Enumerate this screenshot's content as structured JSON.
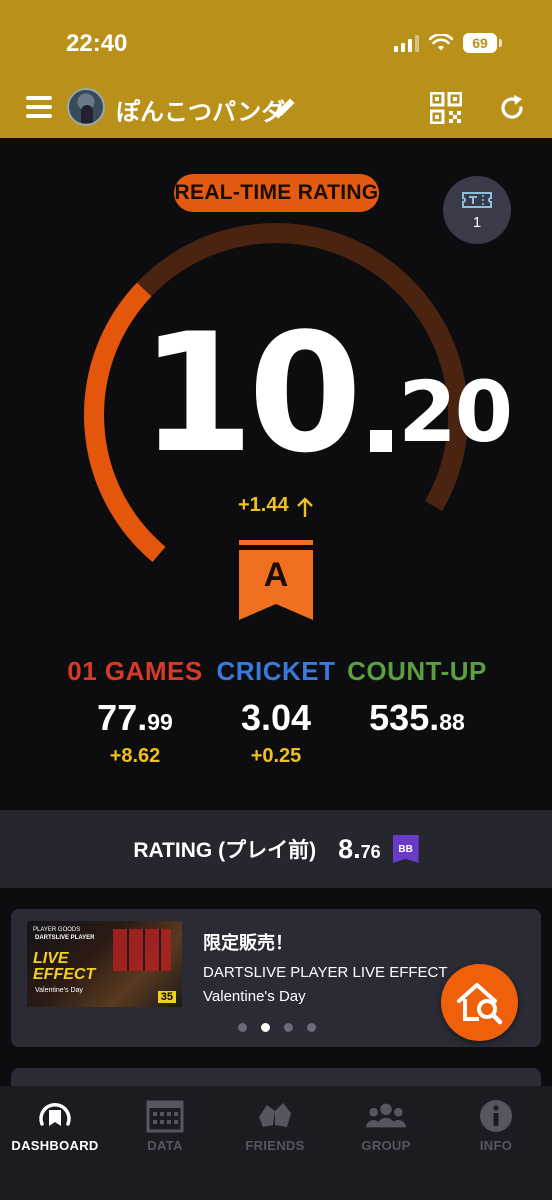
{
  "status_bar": {
    "time": "22:40",
    "battery": "69"
  },
  "header": {
    "username": "ぽんこつパンダ"
  },
  "rating": {
    "badge": "REAL-TIME RATING",
    "ticket_count": "1",
    "integer": "10",
    "decimal": "20",
    "delta": "+1.44",
    "class": "A",
    "gauge_fraction": 0.36
  },
  "stats": [
    {
      "label": "01 GAMES",
      "value_int": "77.",
      "value_dec": "99",
      "delta": "+8.62",
      "color": "#d83a2a"
    },
    {
      "label": "CRICKET",
      "value_int": "3.04",
      "value_dec": "",
      "delta": "+0.25",
      "color": "#3a7adc"
    },
    {
      "label": "COUNT-UP",
      "value_int": "535.",
      "value_dec": "88",
      "delta": "",
      "color": "#5aa040"
    }
  ],
  "pre_rating": {
    "label": "RATING (プレイ前)",
    "value_int": "8.",
    "value_dec": "76",
    "badge": "BB"
  },
  "news": {
    "title": "限定販売！",
    "line1": "DARTSLIVE PLAYER LIVE EFFECT",
    "line2": "Valentine's Day",
    "thumb_top": "PLAYER GOODS",
    "thumb_sub": "DARTSLIVE PLAYER",
    "thumb_effect_1": "LIVE",
    "thumb_effect_2": "EFFECT",
    "thumb_caption": "Valentine's Day",
    "thumb_badge": "35",
    "active_dot": 1
  },
  "nav": [
    {
      "label": "DASHBOARD",
      "icon": "dashboard-icon",
      "active": true
    },
    {
      "label": "DATA",
      "icon": "calendar-icon",
      "active": false
    },
    {
      "label": "FRIENDS",
      "icon": "friends-icon",
      "active": false
    },
    {
      "label": "GROUP",
      "icon": "group-icon",
      "active": false
    },
    {
      "label": "INFO",
      "icon": "info-icon",
      "active": false
    }
  ],
  "colors": {
    "header": "#b8901a",
    "accent": "#e45a10",
    "delta": "#f0c020"
  }
}
